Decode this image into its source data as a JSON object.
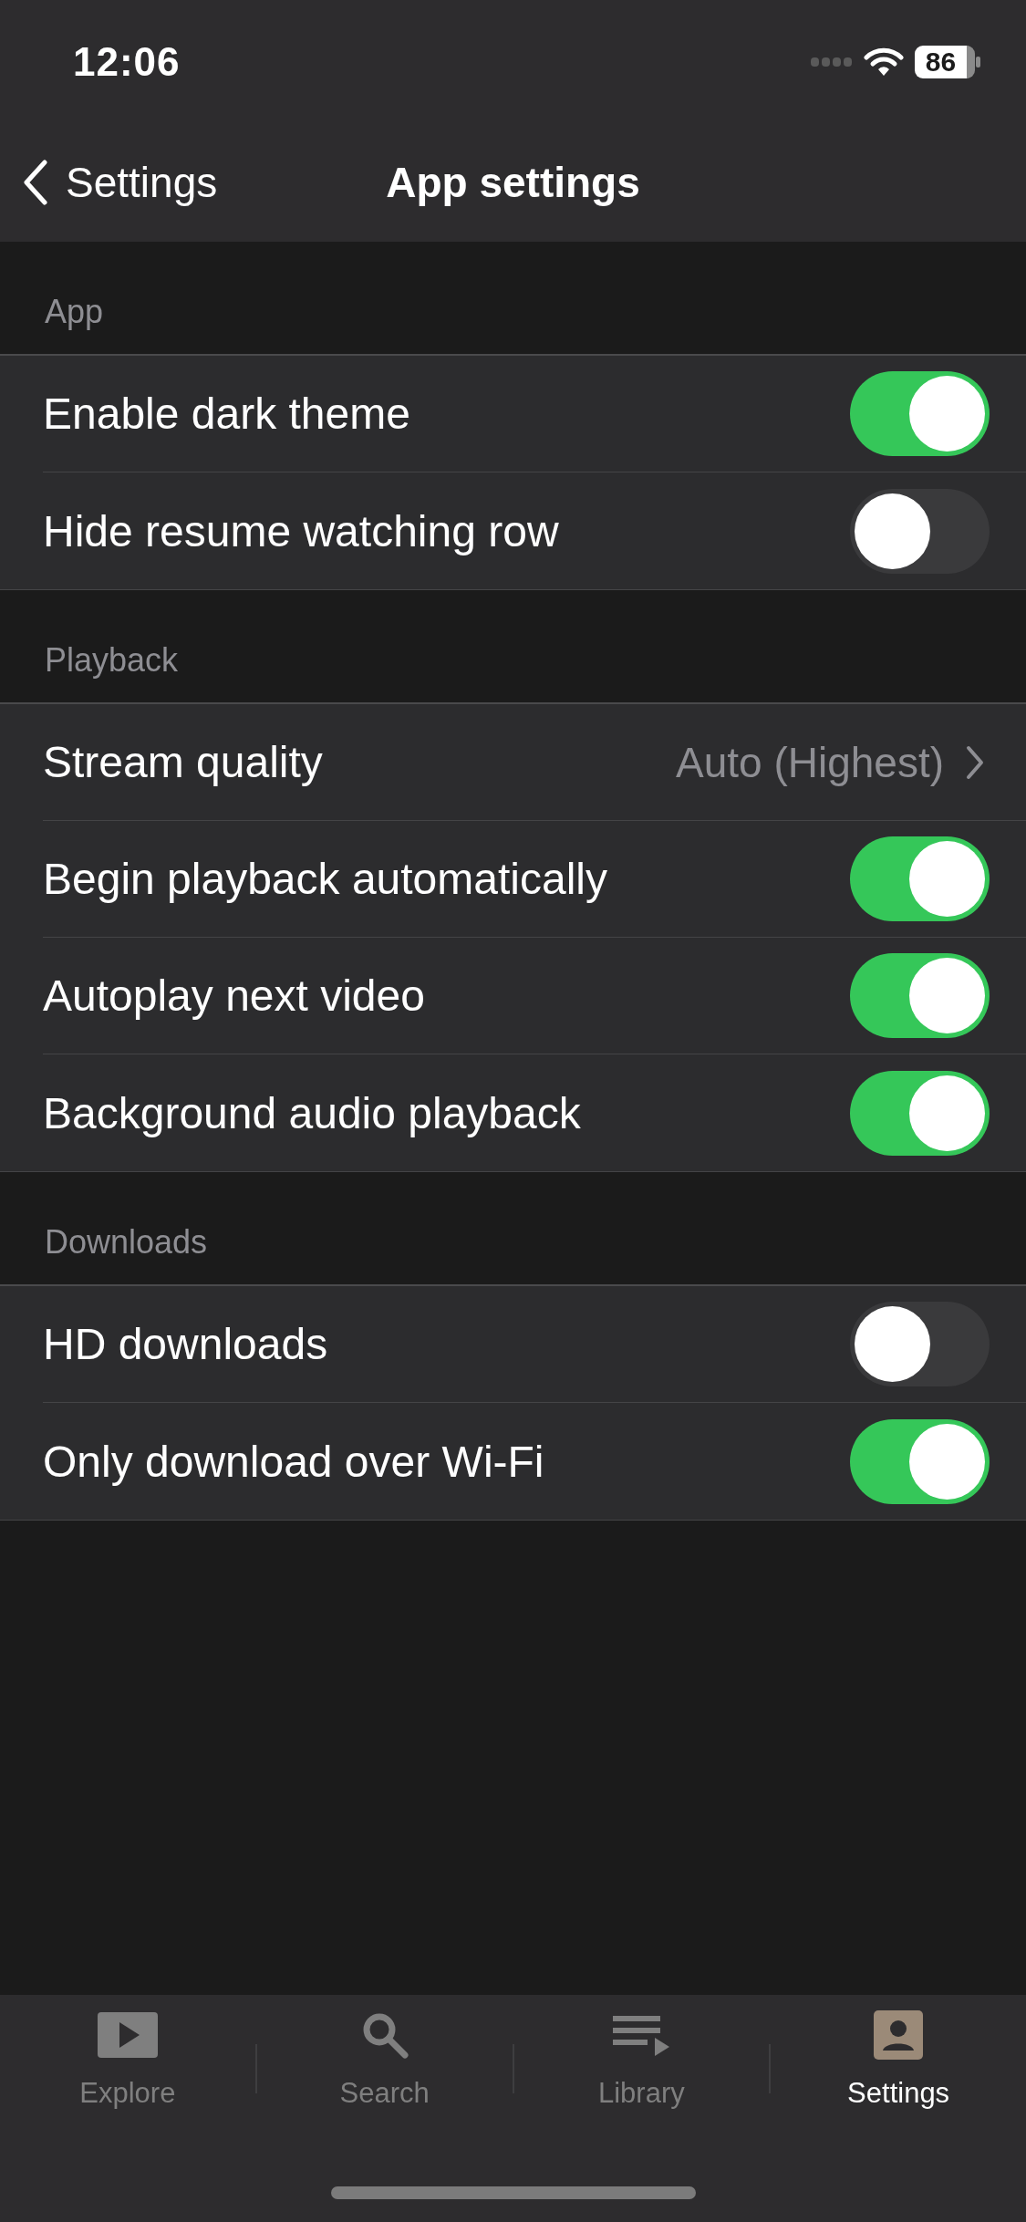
{
  "status_bar": {
    "time": "12:06",
    "battery": "86"
  },
  "nav": {
    "back": "Settings",
    "title": "App settings"
  },
  "sections": [
    {
      "header": "App",
      "rows": [
        {
          "kind": "toggle",
          "label": "Enable dark theme",
          "on": true
        },
        {
          "kind": "toggle",
          "label": "Hide resume watching row",
          "on": false
        }
      ]
    },
    {
      "header": "Playback",
      "rows": [
        {
          "kind": "disclosure",
          "label": "Stream quality",
          "value": "Auto (Highest)"
        },
        {
          "kind": "toggle",
          "label": "Begin playback automatically",
          "on": true
        },
        {
          "kind": "toggle",
          "label": "Autoplay next video",
          "on": true
        },
        {
          "kind": "toggle",
          "label": "Background audio playback",
          "on": true
        }
      ]
    },
    {
      "header": "Downloads",
      "rows": [
        {
          "kind": "toggle",
          "label": "HD downloads",
          "on": false
        },
        {
          "kind": "toggle",
          "label": "Only download over Wi-Fi",
          "on": true
        }
      ]
    }
  ],
  "tabs": [
    {
      "kind": "explore",
      "label": "Explore",
      "selected": false
    },
    {
      "kind": "search",
      "label": "Search",
      "selected": false
    },
    {
      "kind": "library",
      "label": "Library",
      "selected": false
    },
    {
      "kind": "settings",
      "label": "Settings",
      "selected": true
    }
  ]
}
